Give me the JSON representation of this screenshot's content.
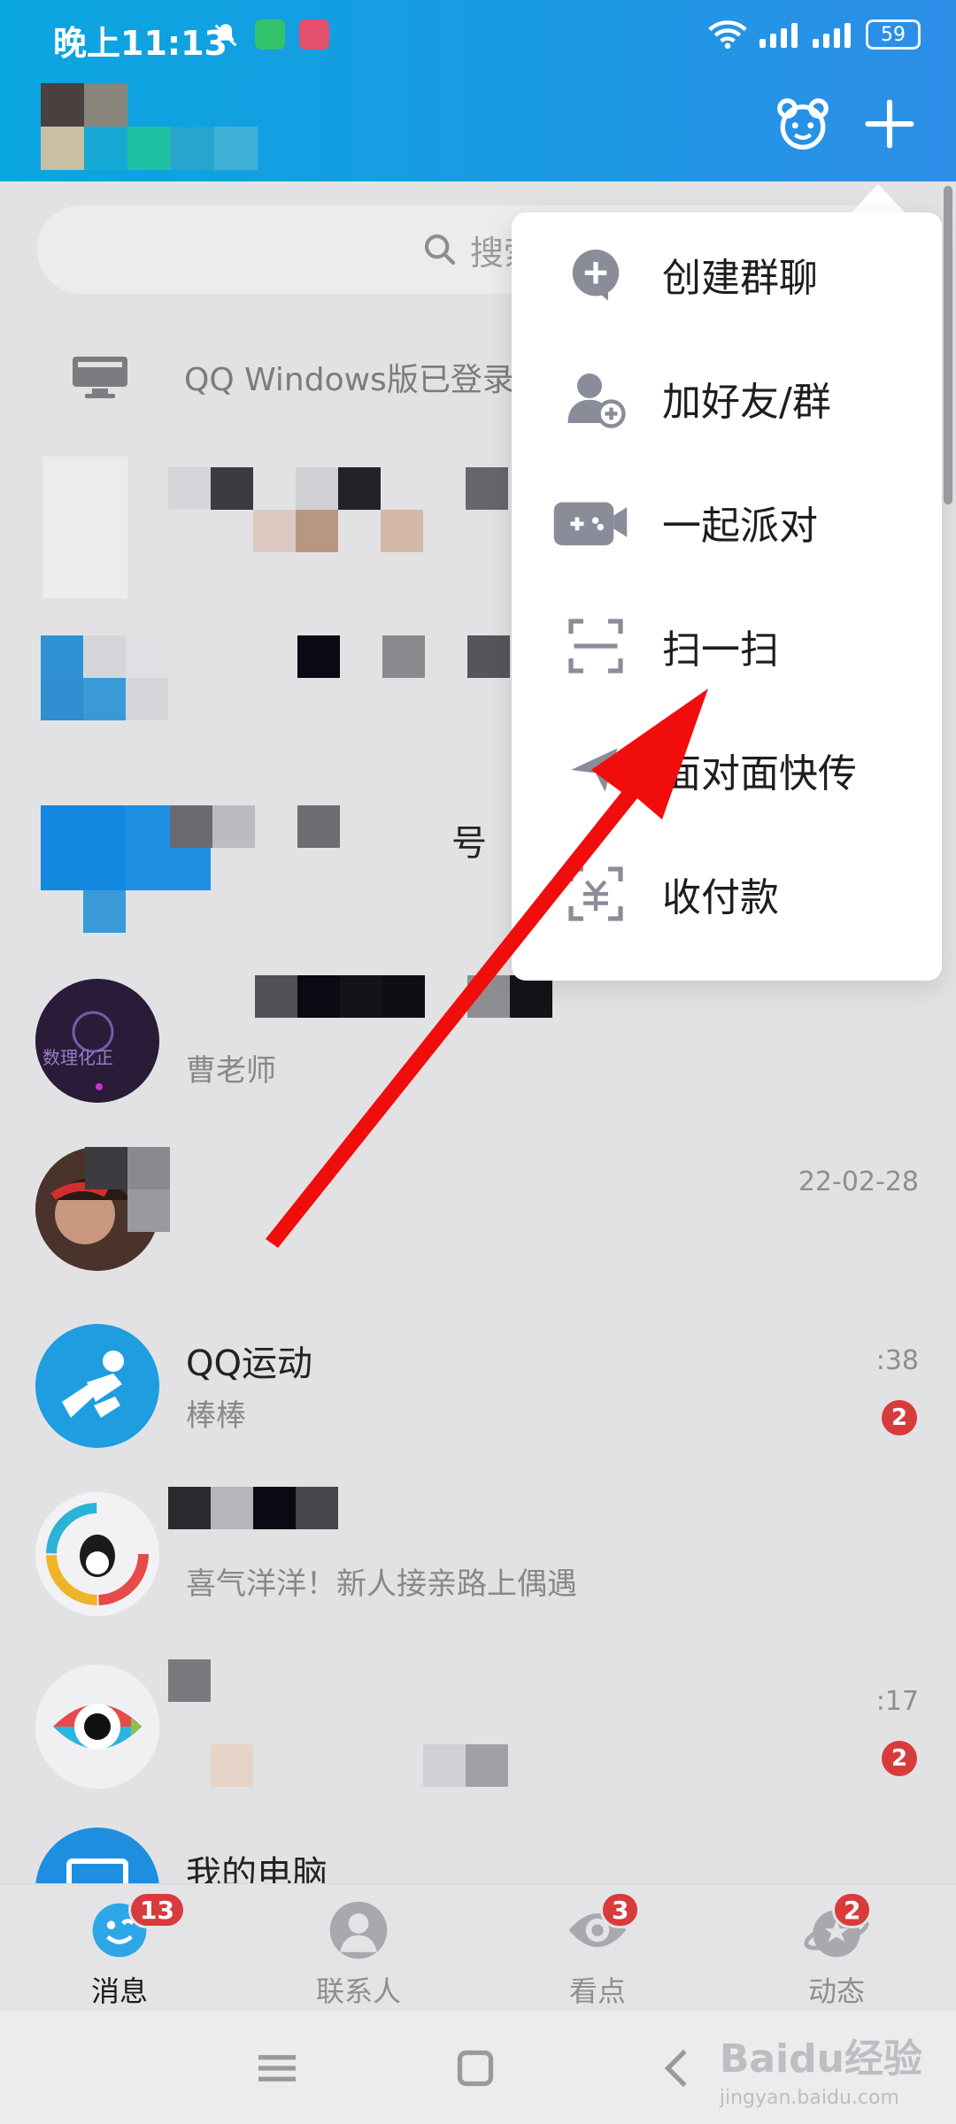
{
  "status_bar": {
    "time": "晚上11:13",
    "battery": "59"
  },
  "search": {
    "placeholder": "搜索"
  },
  "pc_login": {
    "text": "QQ Windows版已登录"
  },
  "popup_menu": {
    "items": [
      {
        "label": "创建群聊",
        "icon": "create-group-icon"
      },
      {
        "label": "加好友/群",
        "icon": "add-friend-icon"
      },
      {
        "label": "一起派对",
        "icon": "party-game-icon"
      },
      {
        "label": "扫一扫",
        "icon": "scan-icon"
      },
      {
        "label": "面对面快传",
        "icon": "face-to-face-transfer-icon"
      },
      {
        "label": "收付款",
        "icon": "payment-icon"
      }
    ]
  },
  "chat_list": [
    {
      "title": "",
      "subtitle": "",
      "time": ""
    },
    {
      "title": "",
      "subtitle": "",
      "time": ""
    },
    {
      "title": "号",
      "subtitle": "",
      "time": ""
    },
    {
      "title": "",
      "subtitle": "曹老师",
      "time": ""
    },
    {
      "title": "",
      "subtitle": "",
      "time": "22-02-28"
    },
    {
      "title": "QQ运动",
      "subtitle": "棒棒",
      "time": ":38",
      "badge": "2"
    },
    {
      "title": "",
      "subtitle": "喜气洋洋！新人接亲路上偶遇",
      "time": ""
    },
    {
      "title": "",
      "subtitle": "",
      "time": ":17",
      "badge": "2"
    },
    {
      "title": "我的电脑",
      "subtitle": "",
      "time": ""
    }
  ],
  "tabs": [
    {
      "label": "消息",
      "icon": "message-icon",
      "badge": "13",
      "active": true
    },
    {
      "label": "联系人",
      "icon": "contacts-icon",
      "badge": "",
      "active": false
    },
    {
      "label": "看点",
      "icon": "watch-icon",
      "badge": "3",
      "active": false
    },
    {
      "label": "动态",
      "icon": "moments-icon",
      "badge": "2",
      "active": false
    }
  ],
  "watermark": {
    "brand": "Baidu经验",
    "url": "jingyan.baidu.com"
  },
  "colors": {
    "header_start": "#0aa6df",
    "header_end": "#2d8ee8",
    "badge_red": "#d83b3b",
    "arrow_red": "#f20d0d"
  }
}
